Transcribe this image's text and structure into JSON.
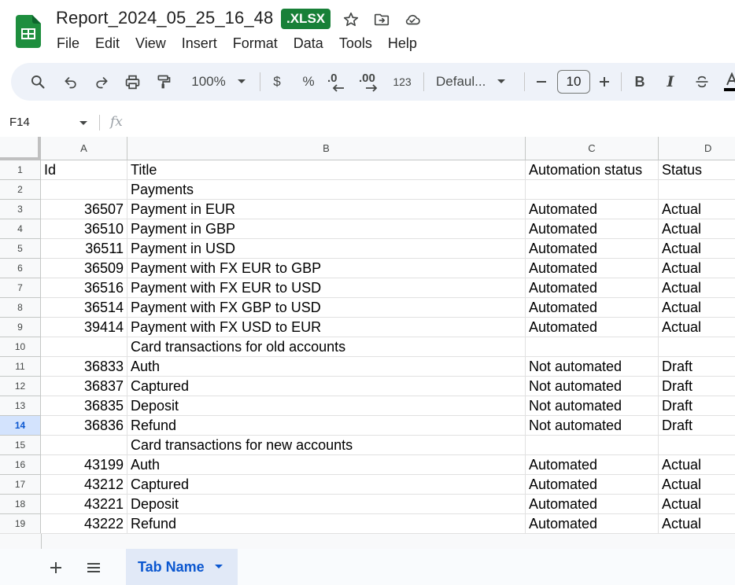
{
  "window": {
    "doc_title": "Report_2024_05_25_16_48",
    "file_badge": ".XLSX"
  },
  "menu": [
    "File",
    "Edit",
    "View",
    "Insert",
    "Format",
    "Data",
    "Tools",
    "Help"
  ],
  "toolbar": {
    "zoom": "100%",
    "currency": "$",
    "percent": "%",
    "decrease_decimal": ".0",
    "increase_decimal": ".00",
    "number_format": "123",
    "font": "Defaul...",
    "font_size": "10",
    "bold": "B",
    "italic": "I"
  },
  "formula_bar": {
    "name_box": "F14",
    "fx": "fx"
  },
  "columns": [
    {
      "letter": "A",
      "header": "Id"
    },
    {
      "letter": "B",
      "header": "Title"
    },
    {
      "letter": "C",
      "header": "Automation status"
    },
    {
      "letter": "D",
      "header": "Status"
    }
  ],
  "active_row": 14,
  "rows": [
    {
      "n": "1",
      "id": "Id",
      "title": "Title",
      "automation": "Automation status",
      "status": "Status"
    },
    {
      "n": "2",
      "id": "",
      "title": "Payments",
      "automation": "",
      "status": ""
    },
    {
      "n": "3",
      "id": "36507",
      "title": "Payment in EUR",
      "automation": "Automated",
      "status": "Actual"
    },
    {
      "n": "4",
      "id": "36510",
      "title": "Payment in GBP",
      "automation": "Automated",
      "status": "Actual"
    },
    {
      "n": "5",
      "id": "36511",
      "title": "Payment in USD",
      "automation": "Automated",
      "status": "Actual"
    },
    {
      "n": "6",
      "id": "36509",
      "title": "Payment with FX EUR to GBP",
      "automation": "Automated",
      "status": "Actual"
    },
    {
      "n": "7",
      "id": "36516",
      "title": "Payment with FX EUR to USD",
      "automation": "Automated",
      "status": "Actual"
    },
    {
      "n": "8",
      "id": "36514",
      "title": "Payment with FX GBP to USD",
      "automation": "Automated",
      "status": "Actual"
    },
    {
      "n": "9",
      "id": "39414",
      "title": "Payment with FX USD to EUR",
      "automation": "Automated",
      "status": "Actual"
    },
    {
      "n": "10",
      "id": "",
      "title": "Card transactions for old accounts",
      "automation": "",
      "status": ""
    },
    {
      "n": "11",
      "id": "36833",
      "title": "Auth",
      "automation": "Not automated",
      "status": "Draft"
    },
    {
      "n": "12",
      "id": "36837",
      "title": "Captured",
      "automation": "Not automated",
      "status": "Draft"
    },
    {
      "n": "13",
      "id": "36835",
      "title": "Deposit",
      "automation": "Not automated",
      "status": "Draft"
    },
    {
      "n": "14",
      "id": "36836",
      "title": "Refund",
      "automation": "Not automated",
      "status": "Draft"
    },
    {
      "n": "15",
      "id": "",
      "title": "Card transactions for new accounts",
      "automation": "",
      "status": ""
    },
    {
      "n": "16",
      "id": "43199",
      "title": "Auth",
      "automation": "Automated",
      "status": "Actual"
    },
    {
      "n": "17",
      "id": "43212",
      "title": "Captured",
      "automation": "Automated",
      "status": "Actual"
    },
    {
      "n": "18",
      "id": "43221",
      "title": "Deposit",
      "automation": "Automated",
      "status": "Actual"
    },
    {
      "n": "19",
      "id": "43222",
      "title": "Refund",
      "automation": "Automated",
      "status": "Actual"
    }
  ],
  "sheet_tabs": [
    {
      "label": "Tab Name",
      "active": true
    }
  ],
  "colors": {
    "brand_green": "#188038",
    "accent_blue": "#0b57d0",
    "toolbar_bg": "#eef2f9"
  }
}
